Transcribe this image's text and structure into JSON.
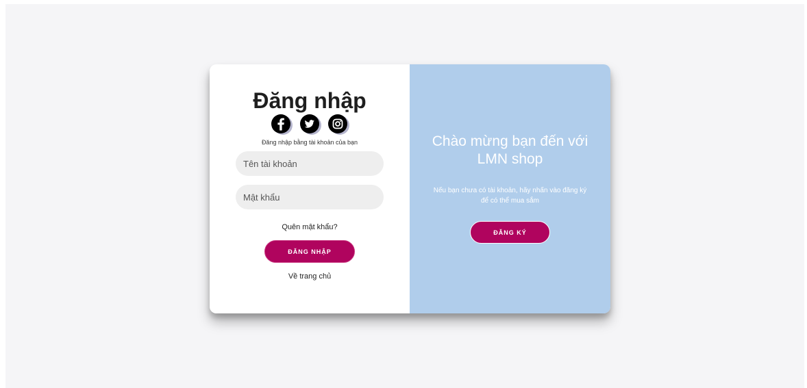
{
  "login": {
    "title": "Đăng nhập",
    "social_icons": [
      "facebook-icon",
      "twitter-icon",
      "instagram-icon"
    ],
    "subtitle": "Đăng nhập bằng tài khoản của bạn",
    "username_placeholder": "Tên tài khoản",
    "password_placeholder": "Mật khẩu",
    "forgot_label": "Quên mật khẩu?",
    "login_button": "ĐĂNG NHẬP",
    "home_link": "Về trang chủ"
  },
  "register_panel": {
    "title": "Chào mừng bạn đến với LMN shop",
    "description": "Nếu bạn chưa có tài khoản, hãy nhấn vào đăng ký để có thể mua sắm",
    "register_button": "ĐĂNG KÝ"
  },
  "colors": {
    "accent": "#b0045e",
    "panel": "#b0cdeb",
    "background": "#f5f5f7"
  }
}
